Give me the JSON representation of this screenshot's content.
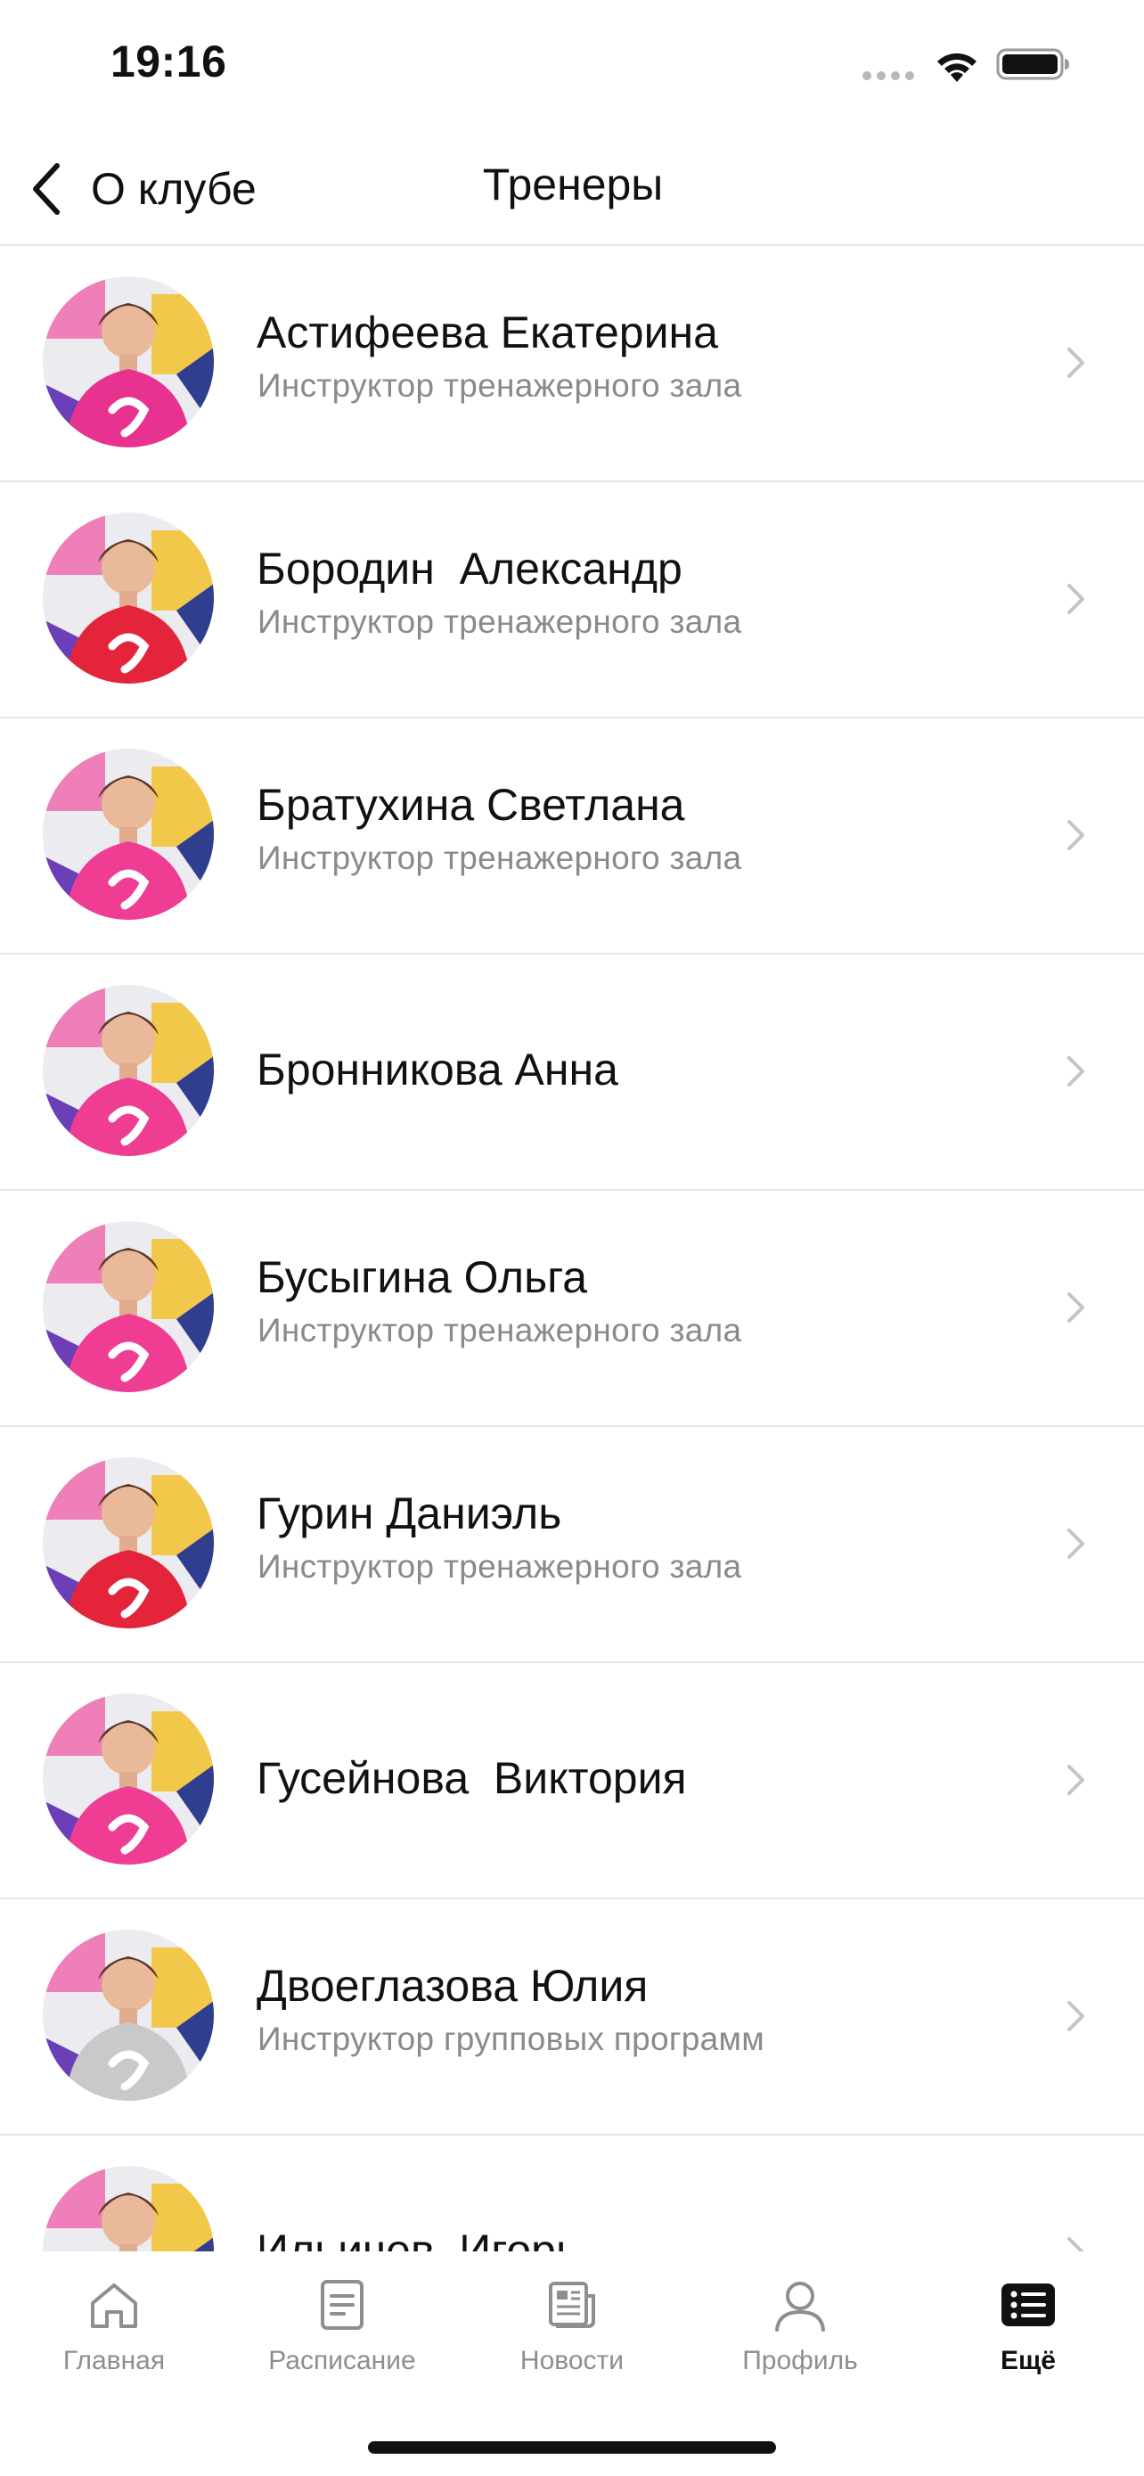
{
  "status_bar": {
    "time": "19:16"
  },
  "nav": {
    "back_label": "О клубе",
    "title": "Тренеры"
  },
  "trainers": [
    {
      "name": "Астифеева Екатерина",
      "role": "Инструктор тренажерного зала",
      "shirt_color": "#e8328f"
    },
    {
      "name": "Бородин  Александр",
      "role": "Инструктор тренажерного зала",
      "shirt_color": "#e3243b"
    },
    {
      "name": "Братухина Светлана",
      "role": "Инструктор тренажерного зала",
      "shirt_color": "#ee3d93"
    },
    {
      "name": "Бронникова Анна",
      "role": "",
      "shirt_color": "#ee3d93"
    },
    {
      "name": "Бусыгина Ольга",
      "role": "Инструктор тренажерного зала",
      "shirt_color": "#ee3d93"
    },
    {
      "name": "Гурин Даниэль",
      "role": "Инструктор тренажерного зала",
      "shirt_color": "#e3243b"
    },
    {
      "name": "Гусейнова  Виктория",
      "role": "",
      "shirt_color": "#ee3d93"
    },
    {
      "name": "Двоеглазова Юлия",
      "role": "Инструктор групповых программ",
      "shirt_color": "#c9c9c9"
    },
    {
      "name": "Ильичев  Игорь",
      "role": "",
      "shirt_color": "#e3243b"
    }
  ],
  "tabs": [
    {
      "label": "Главная",
      "icon": "home-icon",
      "active": false
    },
    {
      "label": "Расписание",
      "icon": "schedule-icon",
      "active": false
    },
    {
      "label": "Новости",
      "icon": "news-icon",
      "active": false
    },
    {
      "label": "Профиль",
      "icon": "profile-icon",
      "active": false
    },
    {
      "label": "Ещё",
      "icon": "more-icon",
      "active": true
    }
  ],
  "colors": {
    "brand_pink": "#ee3d93",
    "brand_red": "#e3243b",
    "accent_yellow": "#f2c84b",
    "accent_purple": "#6a3fb8",
    "secondary_text": "#8a8a8a",
    "separator": "#e6e6e6"
  }
}
